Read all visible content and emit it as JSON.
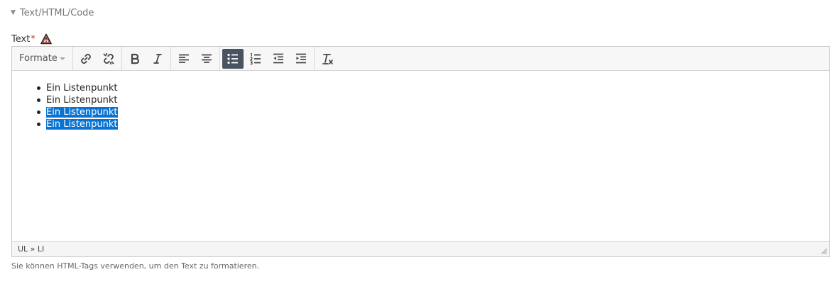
{
  "section": {
    "title": "Text/HTML/Code"
  },
  "field": {
    "label": "Text",
    "required_mark": "*"
  },
  "toolbar": {
    "format_label": "Formate",
    "buttons": [
      {
        "name": "link",
        "icon": "link-icon"
      },
      {
        "name": "unlink",
        "icon": "unlink-icon"
      },
      {
        "name": "bold",
        "icon": "bold-icon"
      },
      {
        "name": "italic",
        "icon": "italic-icon"
      },
      {
        "name": "align-left",
        "icon": "align-left-icon"
      },
      {
        "name": "align-center",
        "icon": "align-center-icon"
      },
      {
        "name": "bullet-list",
        "icon": "bullet-list-icon",
        "active": true
      },
      {
        "name": "numbered-list",
        "icon": "numbered-list-icon"
      },
      {
        "name": "outdent",
        "icon": "outdent-icon"
      },
      {
        "name": "indent",
        "icon": "indent-icon"
      },
      {
        "name": "clear-formatting",
        "icon": "clear-formatting-icon"
      }
    ]
  },
  "editor": {
    "list_items": [
      {
        "text": "Ein Listenpunkt",
        "selected": false
      },
      {
        "text": "Ein Listenpunkt",
        "selected": false
      },
      {
        "text": "Ein Listenpunkt",
        "selected": true
      },
      {
        "text": "Ein Listenpunkt",
        "selected": true
      }
    ],
    "path": "UL » LI"
  },
  "help_text": "Sie können HTML-Tags verwenden, um den Text zu formatieren.",
  "colors": {
    "selection": "#0a73d1",
    "active_button": "#4a5360",
    "required": "#c0392b"
  }
}
